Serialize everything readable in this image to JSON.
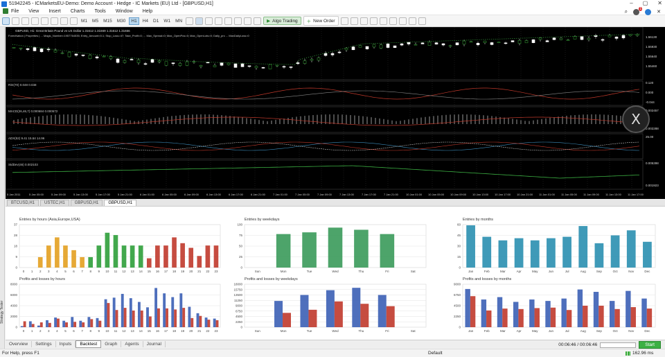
{
  "window": {
    "title": "51942245 - ICMarketsEU-Demo: Demo Account - Hedge - IC Markets (EU) Ltd - [GBPUSD,H1]",
    "controls": [
      "–",
      "▢",
      "✕"
    ]
  },
  "menu": {
    "items": [
      "File",
      "View",
      "Insert",
      "Charts",
      "Tools",
      "Window",
      "Help"
    ],
    "notif_count": "1",
    "close": "✕"
  },
  "toolbar": {
    "timeframes": [
      "M1",
      "M5",
      "M15",
      "M30",
      "H1",
      "H4",
      "D1",
      "W1",
      "MN"
    ],
    "active_tf": "H1",
    "algo_label": "Algo Trading",
    "order_label": "New Order"
  },
  "chart": {
    "header": "GBPUSD, H1:  Great Britain Pound vs US Dollar  1.31612 1.31669 1.31612 1.31656",
    "ea_line": "ForexNation | Properties | ... Magic_Number=1957764535; Entry_Amount=0.1; Stop_Loss=47; Take_Profit=0; ... Max_Spread=0; Max_OpenPos=0; Max_OpenLots=0; Daily_prc ... MaxDailyLoss=0",
    "prices": [
      "1.56130",
      "1.55930",
      "1.55640",
      "1.55460"
    ],
    "rsi_label": "RSI(70) 0.048 0.048",
    "rsi_scale": [
      "0.120",
      "0.000",
      "-0.044"
    ],
    "macd_label": "MACD(26,46,7) 0.000684 0.000572",
    "macd_scale": [
      "0.002457",
      "0.002288"
    ],
    "adx_label": "ADX(52) 9.41 15.64 14.96",
    "adx_scale": [
      "25.00"
    ],
    "std_label": "StdDev(46) 0.002103",
    "std_scale": [
      "0.005398",
      "0.001923"
    ],
    "times": [
      "5 Jan 2011",
      "5 Jan 05:00",
      "5 Jan 09:00",
      "5 Jan 13:00",
      "5 Jan 17:00",
      "5 Jan 21:00",
      "6 Jan 01:00",
      "6 Jan 05:00",
      "6 Jan 09:00",
      "6 Jan 13:00",
      "6 Jan 17:00",
      "6 Jan 21:00",
      "7 Jan 01:00",
      "7 Jan 05:00",
      "7 Jan 09:00",
      "7 Jan 13:00",
      "7 Jan 17:00",
      "7 Jan 21:00",
      "10 Jan 01:00",
      "10 Jan 05:00",
      "10 Jan 09:00",
      "10 Jan 13:00",
      "10 Jan 17:00",
      "10 Jan 21:00",
      "11 Jan 01:00",
      "11 Jan 05:00",
      "11 Jan 09:00",
      "11 Jan 13:00",
      "11 Jan 17:00"
    ]
  },
  "chart_tabs": [
    "BTCUSD,H1",
    "USTEC,H1",
    "GBPUSD,H1",
    "GBPUSD,H1"
  ],
  "chart_tab_active": 3,
  "chart_data": [
    {
      "type": "bar",
      "title": "Entries by hours (Asia,Europe,USA)",
      "categories": [
        "0",
        "1",
        "2",
        "3",
        "4",
        "5",
        "6",
        "7",
        "8",
        "9",
        "10",
        "11",
        "12",
        "13",
        "14",
        "15",
        "16",
        "17",
        "18",
        "19",
        "20",
        "21",
        "22",
        "23"
      ],
      "values": [
        0,
        0,
        9,
        19,
        26,
        19,
        15,
        9,
        9,
        19,
        30,
        28,
        19,
        19,
        19,
        8,
        19,
        19,
        26,
        21,
        17,
        10,
        19,
        19
      ],
      "ylim": [
        0,
        37
      ],
      "yticks": [
        "37",
        "28",
        "18",
        "9",
        "0"
      ],
      "colors": [
        "#e3a020",
        "#2d9e3a",
        "#c0392b"
      ]
    },
    {
      "type": "bar",
      "title": "Entries by weekdays",
      "categories": [
        "Sun",
        "Mon",
        "Tue",
        "Wed",
        "Thu",
        "Fri",
        "Sat"
      ],
      "values": [
        0,
        78,
        82,
        93,
        88,
        78,
        0
      ],
      "ylim": [
        0,
        100
      ],
      "yticks": [
        "100",
        "75",
        "50",
        "25",
        "0"
      ],
      "colors": [
        "#3a9a5a"
      ]
    },
    {
      "type": "bar",
      "title": "Entries by months",
      "categories": [
        "Jan",
        "Feb",
        "Mar",
        "Apr",
        "May",
        "Jun",
        "Jul",
        "Aug",
        "Sep",
        "Oct",
        "Nov",
        "Dec"
      ],
      "values": [
        59,
        43,
        38,
        41,
        38,
        41,
        43,
        58,
        34,
        45,
        52,
        36
      ],
      "ylim": [
        0,
        60
      ],
      "yticks": [
        "60",
        "45",
        "30",
        "15",
        "0"
      ],
      "colors": [
        "#2a8fb0"
      ]
    },
    {
      "type": "bar",
      "title": "Profits and losses by hours",
      "categories": [
        "0",
        "1",
        "2",
        "3",
        "4",
        "5",
        "6",
        "7",
        "8",
        "9",
        "10",
        "11",
        "12",
        "13",
        "14",
        "15",
        "16",
        "17",
        "18",
        "19",
        "20",
        "21",
        "22",
        "23"
      ],
      "series": [
        {
          "values": [
            200,
            1100,
            300,
            1300,
            1800,
            1200,
            1900,
            1200,
            1900,
            1700,
            5200,
            5500,
            6200,
            5400,
            4700,
            3700,
            7300,
            6300,
            5600,
            6300,
            3800,
            2600,
            1800,
            1600
          ]
        },
        {
          "values": [
            1100,
            600,
            900,
            800,
            1600,
            900,
            1000,
            900,
            1500,
            1200,
            4500,
            3200,
            3600,
            3100,
            3100,
            2000,
            3500,
            3500,
            3300,
            3600,
            1700,
            2100,
            1400,
            1300
          ]
        }
      ],
      "ylim": [
        0,
        8000
      ],
      "yticks": [
        "8000",
        "6000",
        "4000",
        "2000",
        "0"
      ],
      "colors": [
        "#3b5fb5",
        "#c0392b"
      ]
    },
    {
      "type": "bar",
      "title": "Profits and losses by weekdays",
      "categories": [
        "Sun",
        "Mon",
        "Tue",
        "Wed",
        "Thu",
        "Fri",
        "Sat"
      ],
      "series": [
        {
          "values": [
            0,
            11000,
            13500,
            15500,
            16500,
            13500,
            0
          ]
        },
        {
          "values": [
            0,
            6000,
            7300,
            10800,
            9800,
            8800,
            0
          ]
        }
      ],
      "ylim": [
        0,
        18000
      ],
      "yticks": [
        "18000",
        "15750",
        "13500",
        "11250",
        "9000",
        "6750",
        "4500",
        "2250",
        "0"
      ],
      "colors": [
        "#3b5fb5",
        "#c0392b"
      ]
    },
    {
      "type": "bar",
      "title": "Profits and losses by months",
      "categories": [
        "Jan",
        "Feb",
        "Mar",
        "Apr",
        "May",
        "Jun",
        "Jul",
        "Aug",
        "Sep",
        "Oct",
        "Nov",
        "Dec"
      ],
      "series": [
        {
          "values": [
            8000,
            5800,
            6300,
            5300,
            5800,
            5500,
            6000,
            7900,
            7400,
            5500,
            7600,
            6000
          ]
        },
        {
          "values": [
            6500,
            3500,
            3900,
            3800,
            4000,
            4100,
            3600,
            4500,
            4500,
            3800,
            4200,
            3900
          ]
        }
      ],
      "ylim": [
        0,
        9000
      ],
      "yticks": [
        "9000",
        "6750",
        "4500",
        "2250",
        "0"
      ],
      "colors": [
        "#3b5fb5",
        "#c0392b"
      ]
    }
  ],
  "tester_side": "Strategy Tester",
  "bottom_tabs": [
    "Overview",
    "Settings",
    "Inputs",
    "Backtest",
    "Graph",
    "Agents",
    "Journal"
  ],
  "bottom_tab_active": 3,
  "timer": "00:06:46 / 00:06:46",
  "start": "Start",
  "status": {
    "help": "For Help, press F1",
    "profile": "Default",
    "ping": "162.96 ms"
  },
  "floating_label": "X"
}
